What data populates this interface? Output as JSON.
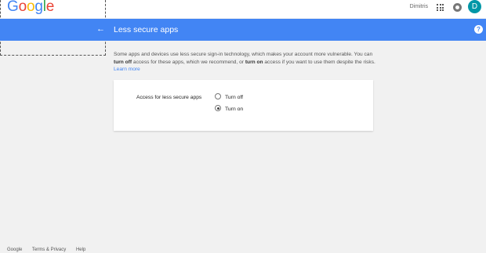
{
  "topbar": {
    "logo": [
      "G",
      "o",
      "o",
      "g",
      "l",
      "e"
    ],
    "user_name": "Dimitris",
    "avatar_letter": "D"
  },
  "header": {
    "title": "Less secure apps",
    "back_icon": "arrow-left-icon",
    "help_icon": "help-icon",
    "help_glyph": "?",
    "color": "#4285f4"
  },
  "description": {
    "part1": "Some apps and devices use less secure sign-in technology, which makes your account more vulnerable. You can ",
    "turn_off": "turn off",
    "part2": " access for these apps, which we recommend, or ",
    "turn_on": "turn on",
    "part3": " access if you want to use them despite the risks. ",
    "learn_more": "Learn more"
  },
  "setting": {
    "label": "Access for less secure apps",
    "options": [
      {
        "label": "Turn off",
        "selected": false
      },
      {
        "label": "Turn on",
        "selected": true
      }
    ]
  },
  "footer": {
    "links": [
      "Google",
      "Terms & Privacy",
      "Help"
    ]
  }
}
